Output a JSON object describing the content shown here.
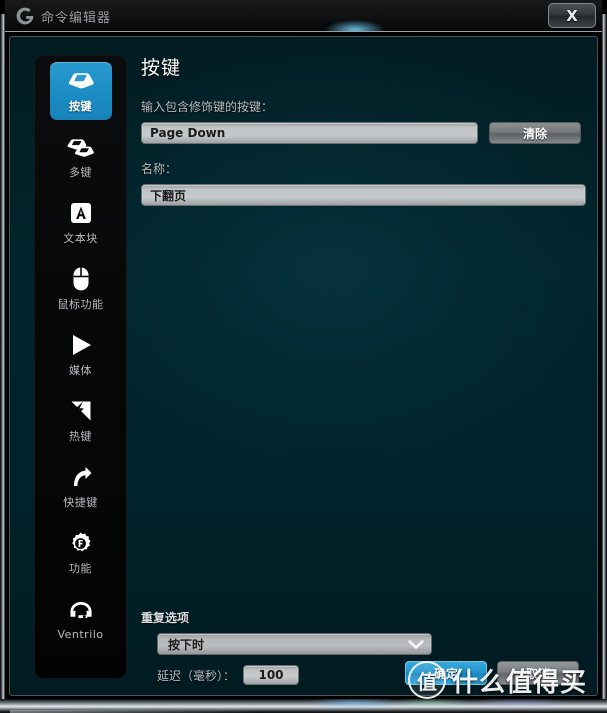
{
  "window": {
    "title": "命令编辑器",
    "logo_icon": "g-logo-icon",
    "close_label": "X"
  },
  "sidebar": {
    "items": [
      {
        "label": "按键",
        "icon": "keycap-icon",
        "selected": true
      },
      {
        "label": "多键",
        "icon": "multikey-icon",
        "selected": false
      },
      {
        "label": "文本块",
        "icon": "textblock-icon",
        "selected": false
      },
      {
        "label": "鼠标功能",
        "icon": "mouse-icon",
        "selected": false
      },
      {
        "label": "媒体",
        "icon": "play-icon",
        "selected": false
      },
      {
        "label": "热键",
        "icon": "hotkey-icon",
        "selected": false
      },
      {
        "label": "快捷键",
        "icon": "shortcut-icon",
        "selected": false
      },
      {
        "label": "功能",
        "icon": "gear-f-icon",
        "selected": false
      },
      {
        "label": "Ventrilo",
        "icon": "headset-icon",
        "selected": false
      }
    ]
  },
  "main": {
    "page_title": "按键",
    "key_label": "输入包含修饰键的按键：",
    "key_value": "Page Down",
    "clear_label": "清除",
    "name_label": "名称：",
    "name_value": "下翻页"
  },
  "repeat": {
    "title": "重复选项",
    "mode_value": "按下时",
    "delay_label": "延迟（毫秒）：",
    "delay_value": "100"
  },
  "footer": {
    "ok_label": "确定",
    "cancel_label": "取消"
  },
  "watermark": {
    "badge": "值",
    "text": "什么值得买"
  },
  "colors": {
    "accent_blue": "#1f95cd",
    "panel_teal": "#01242c",
    "sidebar_black": "#060707",
    "field_gray": "#c1c4c6"
  }
}
